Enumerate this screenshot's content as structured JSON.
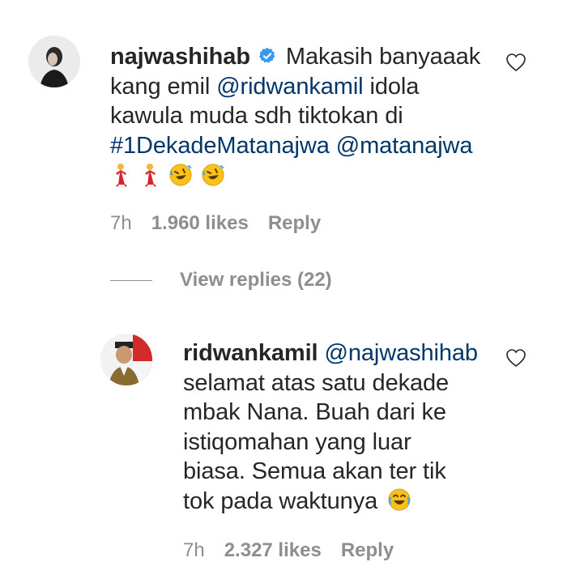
{
  "comments": [
    {
      "username": "najwashihab",
      "verified": true,
      "text_pre": "Makasih banyaaak kang emil",
      "mention": "@ridwankamil",
      "text_mid1": "idola",
      "line2": "kawula muda sdh tiktokan di",
      "hashtag": "#1DekadeMatanajwa",
      "mention2": "@matanajwa",
      "emojis": [
        "woman-dancing",
        "woman-dancing",
        "rolling-laughing",
        "rolling-laughing"
      ],
      "time": "7h",
      "likes": "1.960 likes",
      "reply": "Reply"
    },
    {
      "username": "ridwankamil",
      "mention": "@najwashihab",
      "line1": "selamat atas satu dekade",
      "line2": "mbak Nana. Buah dari ke",
      "line3": "istiqomahan yang luar",
      "line4": "biasa. Semua akan ter tik",
      "line5": "tok pada waktunya",
      "emoji": "tears-of-joy",
      "time": "7h",
      "likes": "2.327 likes",
      "reply": "Reply"
    }
  ],
  "view_replies": "View replies (22)",
  "icons": {
    "like": "heart-outline-icon",
    "verified": "verified-badge-icon"
  },
  "colors": {
    "link": "#00376b",
    "verified": "#3897f0",
    "meta": "#8e8e8e"
  }
}
